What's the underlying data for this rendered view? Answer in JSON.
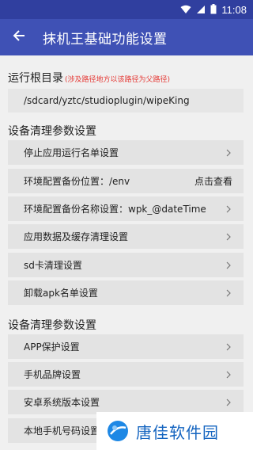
{
  "status_bar": {
    "time": "11:08",
    "icons": [
      "wifi-icon",
      "signal-icon",
      "battery-icon"
    ],
    "background": "#303f9f"
  },
  "app_bar": {
    "title": "抹机王基础功能设置",
    "back_icon": "arrow-back-icon",
    "background": "#3f51b5"
  },
  "run_root": {
    "title": "运行根目录",
    "note": "(涉及路径地方以该路径为父路径)",
    "path": "/sdcard/yztc/studioplugin/wipeKing"
  },
  "section1": {
    "title": "设备清理参数设置",
    "items": [
      {
        "label": "停止应用运行名单设置",
        "action": ""
      },
      {
        "label": "环境配置备份位置：/env",
        "action": "点击查看"
      },
      {
        "label": "环境配置备份名称设置：wpk_@dateTime",
        "action": ""
      },
      {
        "label": "应用数据及缓存清理设置",
        "action": ""
      },
      {
        "label": "sd卡清理设置",
        "action": ""
      },
      {
        "label": "卸载apk名单设置",
        "action": ""
      }
    ]
  },
  "section2": {
    "title": "设备清理参数设置",
    "items": [
      {
        "label": "APP保护设置",
        "action": ""
      },
      {
        "label": "手机品牌设置",
        "action": ""
      },
      {
        "label": "安卓系统版本设置",
        "action": ""
      },
      {
        "label": "本地手机号码设置",
        "action": ""
      }
    ]
  },
  "watermark": {
    "text": "唐佳软件园",
    "color": "#1565c0"
  },
  "colors": {
    "accent_note": "#e53935",
    "row_background": "#e3e3e3",
    "page_background": "#f0f0f0"
  }
}
